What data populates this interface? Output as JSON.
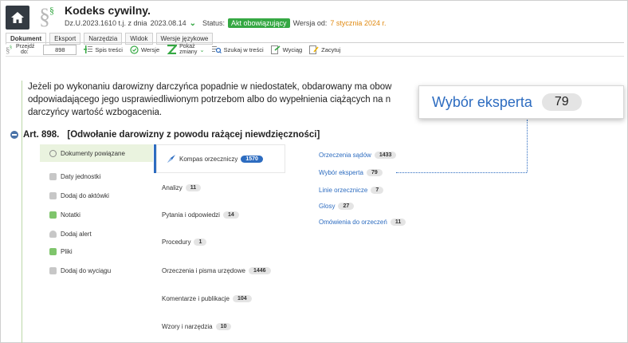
{
  "header": {
    "title": "Kodeks cywilny.",
    "citation": "Dz.U.2023.1610 t.j. z dnia",
    "date": "2023.08.14",
    "status_label": "Status:",
    "status_value": "Akt obowiązujący",
    "version_label": "Wersja od:",
    "version_date": "7 stycznia 2024 r."
  },
  "tabs": [
    "Dokument",
    "Eksport",
    "Narzędzia",
    "Widok",
    "Wersje językowe"
  ],
  "toolbar": {
    "goto_label_1": "Przejdź",
    "goto_label_2": "do:",
    "goto_value": "898",
    "toc": "Spis treści",
    "versions": "Wersje",
    "show_changes_1": "Pokaż",
    "show_changes_2": "zmiany",
    "search_in_text": "Szukaj w treści",
    "excerpt": "Wyciąg",
    "bookmark": "Zacytuj"
  },
  "passage": {
    "line1": "Jeżeli po wykonaniu darowizny darczyńca popadnie w niedostatek, obdarowany ma obow",
    "line2": "odpowiadającego jego usprawiedliwionym potrzebom albo do wypełnienia ciążących na n",
    "line3": "darczyńcy wartość wzbogacenia."
  },
  "article": {
    "number": "Art. 898.",
    "title": "[Odwołanie darowizny z powodu rażącej niewdzięczności]"
  },
  "left_menu": [
    "Dokumenty powiązane",
    "Daty jednostki",
    "Dodaj do aktówki",
    "Notatki",
    "Dodaj alert",
    "Pliki",
    "Dodaj do wyciągu"
  ],
  "middle_menu": [
    {
      "label": "Kompas orzeczniczy",
      "count": "1570"
    },
    {
      "label": "Analizy",
      "count": "11"
    },
    {
      "label": "Pytania i odpowiedzi",
      "count": "14"
    },
    {
      "label": "Procedury",
      "count": "1"
    },
    {
      "label": "Orzeczenia i pisma urzędowe",
      "count": "1446"
    },
    {
      "label": "Komentarze i publikacje",
      "count": "104"
    },
    {
      "label": "Wzory i narzędzia",
      "count": "10"
    }
  ],
  "right_menu": [
    {
      "label": "Orzeczenia sądów",
      "count": "1433"
    },
    {
      "label": "Wybór eksperta",
      "count": "79"
    },
    {
      "label": "Linie orzecznicze",
      "count": "7"
    },
    {
      "label": "Glosy",
      "count": "27"
    },
    {
      "label": "Omówienia do orzeczeń",
      "count": "11"
    }
  ],
  "callout": {
    "label": "Wybór eksperta",
    "count": "79"
  },
  "colors": {
    "accent_green": "#35a843",
    "accent_blue": "#2d6cc0",
    "version_orange": "#e08a12",
    "home_dark": "#333a42"
  },
  "icons": [
    "home-icon",
    "paragraph-sign-icon",
    "toc-icon",
    "versions-icon",
    "changes-icon",
    "search-text-icon",
    "excerpt-icon",
    "quote-icon",
    "collapse-icon",
    "link-icon",
    "calendar-icon",
    "briefcase-icon",
    "note-icon",
    "bell-icon",
    "file-icon",
    "add-excerpt-icon",
    "compass-icon"
  ]
}
